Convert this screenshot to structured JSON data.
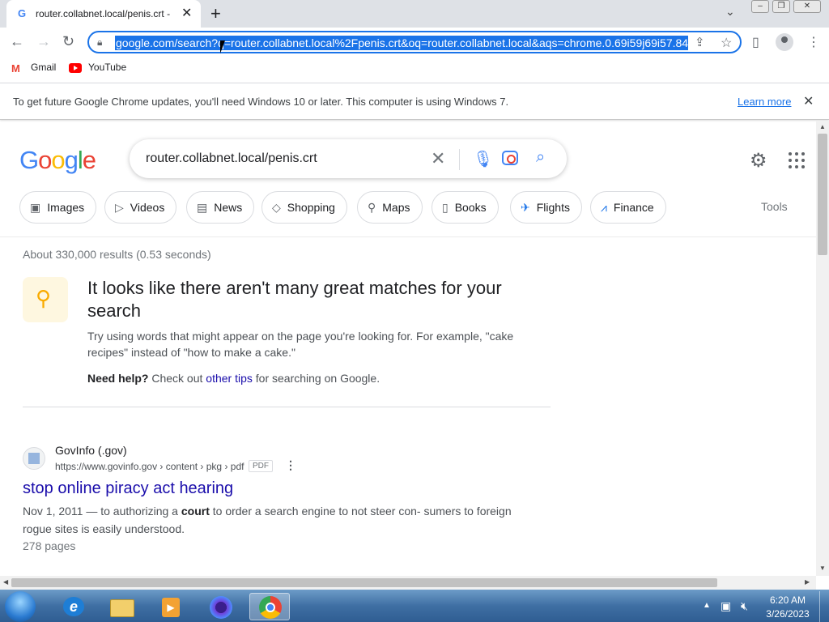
{
  "browser": {
    "tab": {
      "title": "router.collabnet.local/penis.crt - Go",
      "close": "✕"
    },
    "new_tab": "+",
    "window_controls": {
      "minimize": "–",
      "restore": "❐",
      "close": "✕"
    },
    "url": "google.com/search?q=router.collabnet.local%2Fpenis.crt&oq=router.collabnet.local&aqs=chrome.0.69i59j69i57.84",
    "bookmarks": [
      {
        "label": "Gmail"
      },
      {
        "label": "YouTube"
      }
    ],
    "infobar": {
      "text": "To get future Google Chrome updates, you'll need Windows 10 or later. This computer is using Windows 7.",
      "link": "Learn more"
    }
  },
  "google": {
    "query": "router.collabnet.local/penis.crt",
    "chips": [
      {
        "label": "Images",
        "icon": "image-icon"
      },
      {
        "label": "Videos",
        "icon": "video-icon"
      },
      {
        "label": "News",
        "icon": "news-icon"
      },
      {
        "label": "Shopping",
        "icon": "tag-icon"
      },
      {
        "label": "Maps",
        "icon": "pin-icon"
      },
      {
        "label": "Books",
        "icon": "book-icon"
      },
      {
        "label": "Flights",
        "icon": "plane-icon"
      },
      {
        "label": "Finance",
        "icon": "chart-icon"
      }
    ],
    "tools_label": "Tools",
    "stats": "About 330,000 results (0.53 seconds)",
    "tip": {
      "title": "It looks like there aren't many great matches for your search",
      "body": "Try using words that might appear on the page you're looking for. For example, \"cake recipes\" instead of \"how to make a cake.\"",
      "help_bold": "Need help?",
      "help_pre": " Check out ",
      "help_link": "other tips",
      "help_post": " for searching on Google."
    },
    "result": {
      "site_name": "GovInfo (.gov)",
      "url": "https://www.govinfo.gov › content › pkg › pdf",
      "badge": "PDF",
      "title": "stop online piracy act hearing",
      "snippet_pre": "Nov 1, 2011 — to authorizing a ",
      "snippet_bold": "court",
      "snippet_post": " to order a search engine to not steer con- sumers to foreign rogue sites is easily understood.",
      "pages": "278 pages"
    }
  },
  "taskbar": {
    "time": "6:20 AM",
    "date": "3/26/2023"
  }
}
